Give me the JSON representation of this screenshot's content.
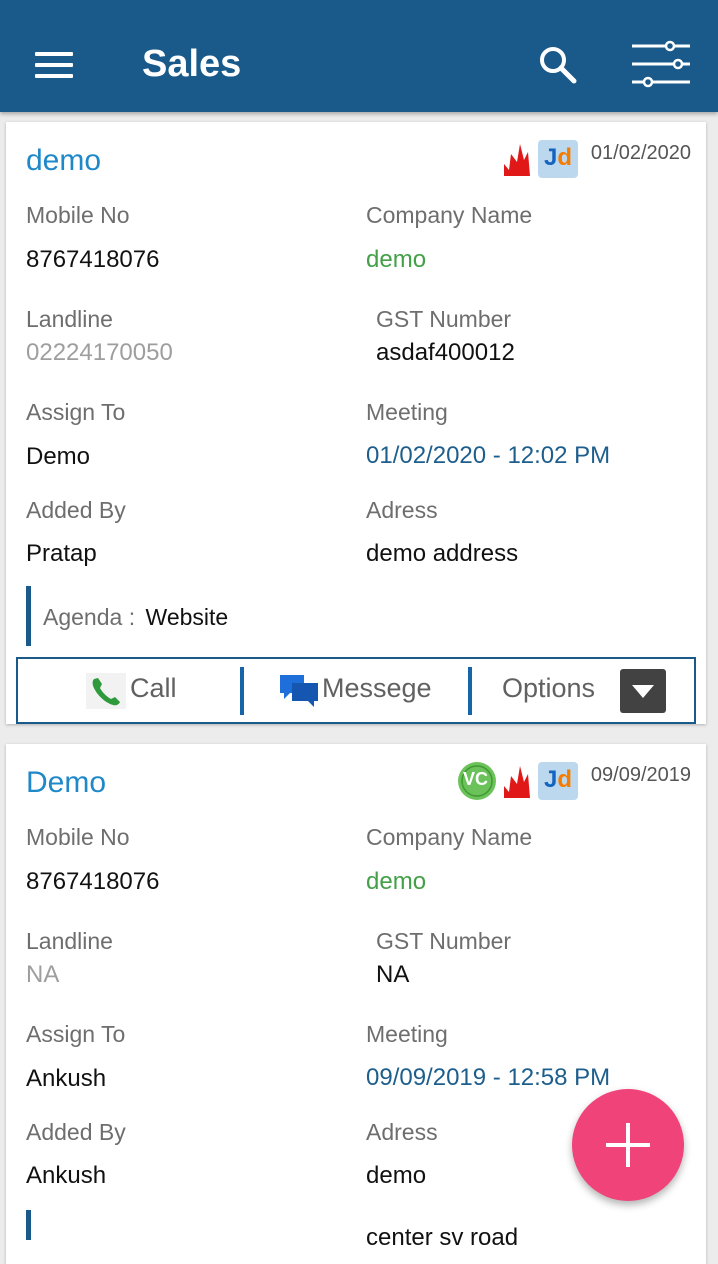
{
  "appbar": {
    "title": "Sales",
    "accent_color": "#1a5a8a"
  },
  "icons": {
    "menu": "hamburger-icon",
    "search": "search-icon",
    "filter": "filter-sliders-icon",
    "add": "plus-icon"
  },
  "labels": {
    "mobile": "Mobile No",
    "company": "Company Name",
    "landline": "Landline",
    "gst": "GST Number",
    "assign": "Assign To",
    "meeting": "Meeting",
    "added_by": "Added By",
    "address": "Adress",
    "agenda": "Agenda :"
  },
  "actions": {
    "call": "Call",
    "message": "Messege",
    "options": "Options"
  },
  "leads": [
    {
      "name": "demo",
      "date": "01/02/2020",
      "sources": [
        "fire",
        "jd"
      ],
      "mobile": "8767418076",
      "company": "demo",
      "landline": "02224170050",
      "gst": "asdaf400012",
      "assign_to": "Demo",
      "meeting": "01/02/2020 - 12:02 PM",
      "added_by": "Pratap",
      "address": "demo address",
      "agenda": "Website"
    },
    {
      "name": "Demo",
      "date": "09/09/2019",
      "sources": [
        "vc",
        "fire",
        "jd"
      ],
      "mobile": "8767418076",
      "company": "demo",
      "landline": "NA",
      "gst": "NA",
      "assign_to": "Ankush",
      "meeting": "09/09/2019 - 12:58 PM",
      "added_by": "Ankush",
      "address": "demo",
      "address_extra": "center sv road"
    }
  ],
  "source_badges": {
    "jd": "Jd",
    "vc": "VC"
  }
}
